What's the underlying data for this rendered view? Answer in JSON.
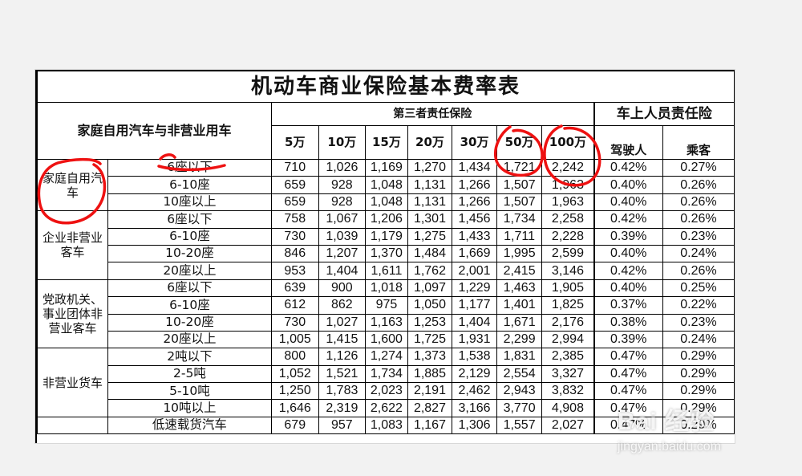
{
  "title": "机动车商业保险基本费率表",
  "headers": {
    "category": "家庭自用汽车与非营业用车",
    "third_party": "第三者责任保险",
    "passenger_liability": "车上人员责任险",
    "amounts": [
      "5万",
      "10万",
      "15万",
      "20万",
      "30万",
      "50万",
      "100万"
    ],
    "driver": "驾驶人",
    "passenger": "乘客"
  },
  "groups": [
    {
      "label": "家庭自用汽车",
      "rows": [
        {
          "type": "6座以下",
          "values": [
            "710",
            "1,026",
            "1,169",
            "1,270",
            "1,434",
            "1,721",
            "2,242"
          ],
          "driver": "0.42%",
          "passenger": "0.27%"
        },
        {
          "type": "6-10座",
          "values": [
            "659",
            "928",
            "1,048",
            "1,131",
            "1,266",
            "1,507",
            "1,963"
          ],
          "driver": "0.40%",
          "passenger": "0.26%"
        },
        {
          "type": "10座以上",
          "values": [
            "659",
            "928",
            "1,048",
            "1,131",
            "1,266",
            "1,507",
            "1,963"
          ],
          "driver": "0.40%",
          "passenger": "0.26%"
        }
      ]
    },
    {
      "label": "企业非营业客车",
      "rows": [
        {
          "type": "6座以下",
          "values": [
            "758",
            "1,067",
            "1,206",
            "1,301",
            "1,456",
            "1,734",
            "2,258"
          ],
          "driver": "0.42%",
          "passenger": "0.26%"
        },
        {
          "type": "6-10座",
          "values": [
            "730",
            "1,039",
            "1,179",
            "1,275",
            "1,433",
            "1,711",
            "2,228"
          ],
          "driver": "0.39%",
          "passenger": "0.23%"
        },
        {
          "type": "10-20座",
          "values": [
            "846",
            "1,207",
            "1,370",
            "1,484",
            "1,669",
            "1,995",
            "2,599"
          ],
          "driver": "0.40%",
          "passenger": "0.24%"
        },
        {
          "type": "20座以上",
          "values": [
            "953",
            "1,404",
            "1,611",
            "1,762",
            "2,001",
            "2,415",
            "3,146"
          ],
          "driver": "0.42%",
          "passenger": "0.26%"
        }
      ]
    },
    {
      "label": "党政机关、事业团体非营业客车",
      "rows": [
        {
          "type": "6座以下",
          "values": [
            "639",
            "900",
            "1,018",
            "1,097",
            "1,229",
            "1,463",
            "1,905"
          ],
          "driver": "0.40%",
          "passenger": "0.25%"
        },
        {
          "type": "6-10座",
          "values": [
            "612",
            "862",
            "975",
            "1,050",
            "1,177",
            "1,401",
            "1,825"
          ],
          "driver": "0.37%",
          "passenger": "0.22%"
        },
        {
          "type": "10-20座",
          "values": [
            "730",
            "1,027",
            "1,163",
            "1,253",
            "1,404",
            "1,671",
            "2,176"
          ],
          "driver": "0.38%",
          "passenger": "0.23%"
        },
        {
          "type": "20座以上",
          "values": [
            "1,005",
            "1,415",
            "1,600",
            "1,725",
            "1,931",
            "2,299",
            "2,994"
          ],
          "driver": "0.39%",
          "passenger": "0.24%"
        }
      ]
    },
    {
      "label": "非营业货车",
      "rows": [
        {
          "type": "2吨以下",
          "values": [
            "800",
            "1,126",
            "1,274",
            "1,373",
            "1,538",
            "1,831",
            "2,385"
          ],
          "driver": "0.47%",
          "passenger": "0.29%"
        },
        {
          "type": "2-5吨",
          "values": [
            "1,052",
            "1,521",
            "1,734",
            "1,885",
            "2,129",
            "2,554",
            "3,327"
          ],
          "driver": "0.47%",
          "passenger": "0.29%"
        },
        {
          "type": "5-10吨",
          "values": [
            "1,250",
            "1,783",
            "2,023",
            "2,191",
            "2,462",
            "2,943",
            "3,832"
          ],
          "driver": "0.47%",
          "passenger": "0.29%"
        },
        {
          "type": "10吨以上",
          "values": [
            "1,646",
            "2,319",
            "2,622",
            "2,827",
            "3,166",
            "3,770",
            "4,908"
          ],
          "driver": "0.47%",
          "passenger": "0.29%"
        }
      ]
    }
  ],
  "last_row": {
    "type": "低速载货汽车",
    "values": [
      "679",
      "957",
      "1,083",
      "1,167",
      "1,306",
      "1,557",
      "2,027"
    ],
    "driver": "0.47%",
    "passenger": "0.29%"
  },
  "watermark": {
    "logo": "Bai 经验",
    "url": "jingyan.baidu.com"
  },
  "annotation_color": "#ee1111"
}
